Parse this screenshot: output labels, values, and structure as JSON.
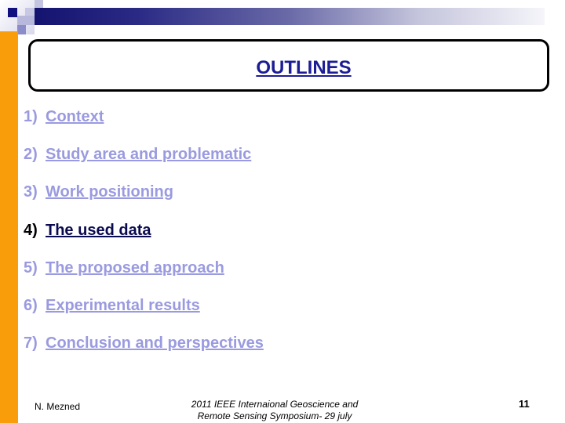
{
  "slide": {
    "title": "OUTLINES",
    "items": [
      {
        "number": "1)",
        "label": "Context",
        "active": false
      },
      {
        "number": "2)",
        "label": "Study area and problematic",
        "active": false
      },
      {
        "number": "3)",
        "label": "Work positioning",
        "active": false
      },
      {
        "number": "4)",
        "label": "The used data",
        "active": true
      },
      {
        "number": "5)",
        "label": "The proposed approach",
        "active": false
      },
      {
        "number": "6)",
        "label": "Experimental results",
        "active": false
      },
      {
        "number": "7)",
        "label": "Conclusion and perspectives",
        "active": false
      }
    ],
    "footer": {
      "author": "N. Mezned",
      "conference_line1": "2011 IEEE Internaional Geoscience and",
      "conference_line2": "Remote Sensing Symposium- 29 july",
      "page_number": "11"
    },
    "colors": {
      "accent_orange": "#f99d0a",
      "title_blue": "#1c1c96",
      "inactive_item": "#9a9ae0",
      "active_item": "#0a0a50"
    }
  }
}
